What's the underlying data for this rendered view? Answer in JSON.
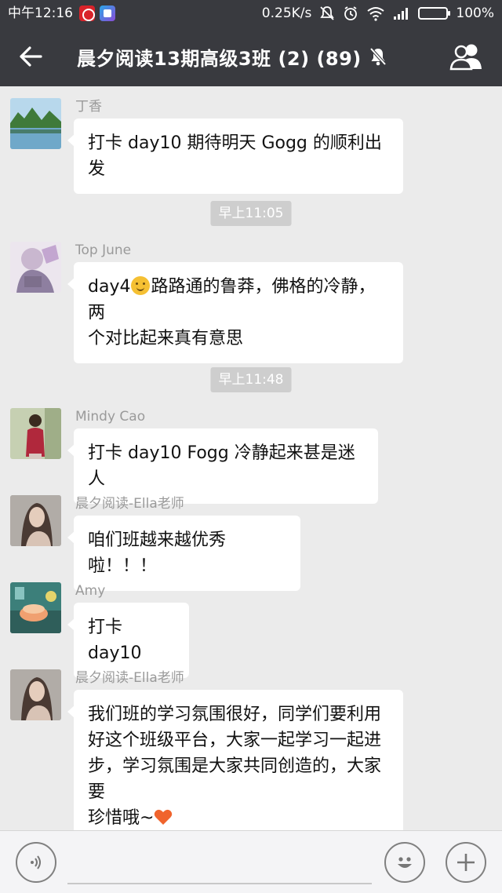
{
  "status_bar": {
    "time": "中午12:16",
    "speed": "0.25K/s",
    "battery": "100%"
  },
  "header": {
    "title": "晨夕阅读13期高级3班 (2) (89)"
  },
  "messages": [
    {
      "sender": "丁香",
      "text": "打卡 day10   期待明天 Gogg 的顺利出发"
    },
    {
      "timestamp": "早上11:05"
    },
    {
      "sender": "Top June",
      "text_part1": "day4",
      "text_part2": "路路通的鲁莽，佛格的冷静，两",
      "text_line2": "个对比起来真有意思"
    },
    {
      "timestamp": "早上11:48"
    },
    {
      "sender": "Mindy Cao",
      "text": "打卡 day10 Fogg 冷静起来甚是迷人"
    },
    {
      "sender": "晨夕阅读-Ella老师",
      "text": "咱们班越来越优秀啦！！！"
    },
    {
      "sender": "Amy",
      "text": "打卡 day10"
    },
    {
      "sender": "晨夕阅读-Ella老师",
      "lines": [
        "我们班的学习氛围很好，同学们要利用",
        "好这个班级平台，大家一起学习一起进",
        "步，学习氛围是大家共同创造的，大家要",
        "珍惜哦~"
      ]
    }
  ],
  "colors": {
    "header_bg": "#393a3f",
    "chat_bg": "#ebebeb",
    "bubble_bg": "#ffffff",
    "heart": "#f0642d"
  }
}
